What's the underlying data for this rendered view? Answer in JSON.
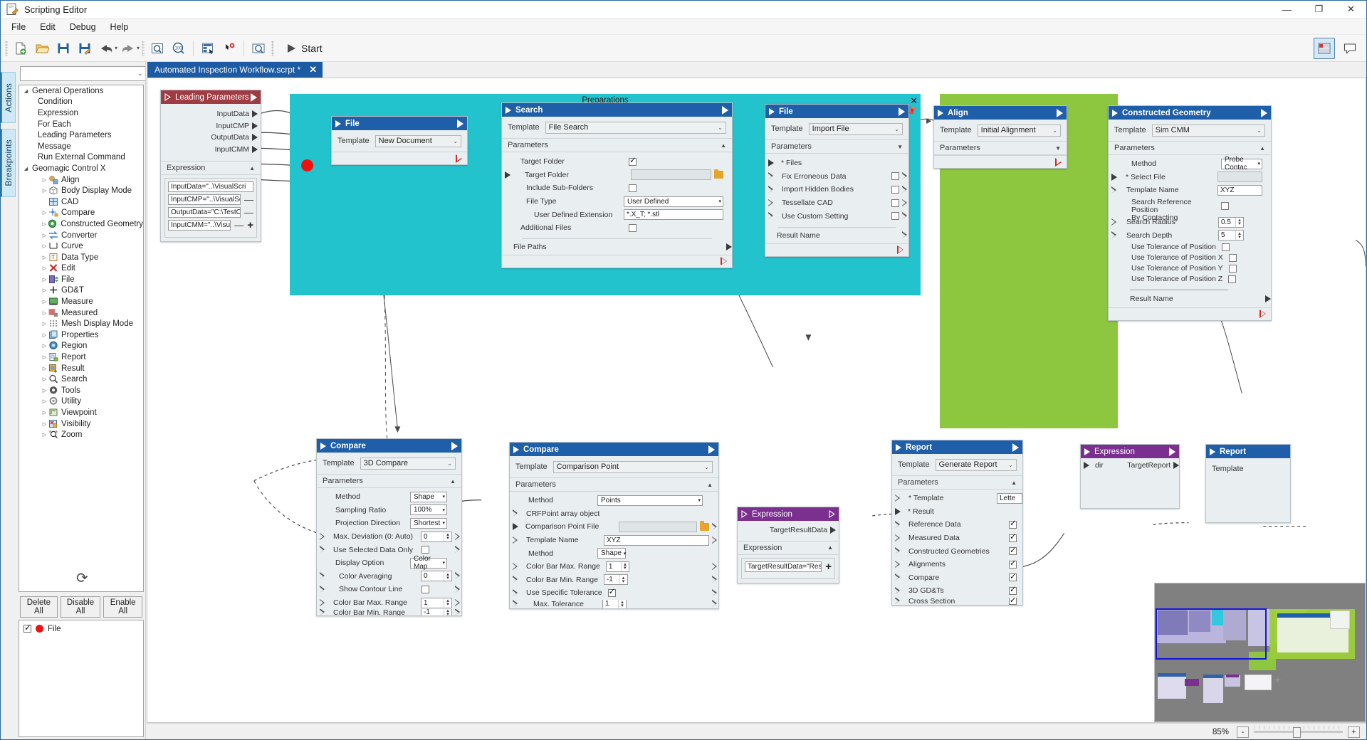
{
  "window": {
    "title": "Scripting Editor",
    "icon": "script-editor-icon",
    "minimize": "—",
    "maximize": "❐",
    "close": "✕"
  },
  "menubar": [
    "File",
    "Edit",
    "Debug",
    "Help"
  ],
  "toolbar": {
    "start_label": "Start",
    "buttons": [
      "new-document-icon",
      "open-folder-icon",
      "save-icon",
      "save-as-icon",
      "undo-icon",
      "redo-icon",
      "zoom-fit-icon",
      "zoom-100-icon",
      "layout-icon",
      "remove-breakpoint-icon",
      "inspect-icon"
    ],
    "right_buttons": [
      "toggle-minimap-icon",
      "toggle-comment-icon"
    ]
  },
  "vertical_tabs": [
    "Actions",
    "Breakpoints"
  ],
  "search": {
    "value": "",
    "placeholder": ""
  },
  "tree": [
    {
      "level": 0,
      "twisty": "expanded",
      "label": "General Operations",
      "icon": ""
    },
    {
      "level": 1,
      "twisty": "",
      "label": "Condition",
      "icon": ""
    },
    {
      "level": 1,
      "twisty": "",
      "label": "Expression",
      "icon": ""
    },
    {
      "level": 1,
      "twisty": "",
      "label": "For Each",
      "icon": ""
    },
    {
      "level": 1,
      "twisty": "",
      "label": "Leading Parameters",
      "icon": ""
    },
    {
      "level": 1,
      "twisty": "",
      "label": "Message",
      "icon": ""
    },
    {
      "level": 1,
      "twisty": "",
      "label": "Run External Command",
      "icon": ""
    },
    {
      "level": 0,
      "twisty": "expanded",
      "label": "Geomagic Control X",
      "icon": ""
    },
    {
      "level": 1,
      "twisty": "collapsed",
      "label": "Align",
      "icon": "align-icon"
    },
    {
      "level": 1,
      "twisty": "collapsed",
      "label": "Body Display Mode",
      "icon": "cube-icon"
    },
    {
      "level": 1,
      "twisty": "",
      "label": "CAD",
      "icon": "cad-icon"
    },
    {
      "level": 1,
      "twisty": "collapsed",
      "label": "Compare",
      "icon": "compare-icon"
    },
    {
      "level": 1,
      "twisty": "collapsed",
      "label": "Constructed Geometry",
      "icon": "geometry-icon"
    },
    {
      "level": 1,
      "twisty": "collapsed",
      "label": "Converter",
      "icon": "converter-icon"
    },
    {
      "level": 1,
      "twisty": "collapsed",
      "label": "Curve",
      "icon": "curve-icon"
    },
    {
      "level": 1,
      "twisty": "collapsed",
      "label": "Data Type",
      "icon": "data-type-icon"
    },
    {
      "level": 1,
      "twisty": "collapsed",
      "label": "Edit",
      "icon": "edit-icon"
    },
    {
      "level": 1,
      "twisty": "collapsed",
      "label": "File",
      "icon": "file-icon"
    },
    {
      "level": 1,
      "twisty": "collapsed",
      "label": "GD&T",
      "icon": "gdt-icon"
    },
    {
      "level": 1,
      "twisty": "collapsed",
      "label": "Measure",
      "icon": "measure-icon"
    },
    {
      "level": 1,
      "twisty": "collapsed",
      "label": "Measured",
      "icon": "measured-icon"
    },
    {
      "level": 1,
      "twisty": "collapsed",
      "label": "Mesh Display Mode",
      "icon": "mesh-icon"
    },
    {
      "level": 1,
      "twisty": "collapsed",
      "label": "Properties",
      "icon": "properties-icon"
    },
    {
      "level": 1,
      "twisty": "collapsed",
      "label": "Region",
      "icon": "region-icon"
    },
    {
      "level": 1,
      "twisty": "collapsed",
      "label": "Report",
      "icon": "report-icon"
    },
    {
      "level": 1,
      "twisty": "collapsed",
      "label": "Result",
      "icon": "result-icon"
    },
    {
      "level": 1,
      "twisty": "collapsed",
      "label": "Search",
      "icon": "search-icon"
    },
    {
      "level": 1,
      "twisty": "collapsed",
      "label": "Tools",
      "icon": "tools-icon"
    },
    {
      "level": 1,
      "twisty": "collapsed",
      "label": "Utility",
      "icon": "gear-icon"
    },
    {
      "level": 1,
      "twisty": "collapsed",
      "label": "Viewpoint",
      "icon": "viewpoint-icon"
    },
    {
      "level": 1,
      "twisty": "collapsed",
      "label": "Visibility",
      "icon": "visibility-icon"
    },
    {
      "level": 1,
      "twisty": "collapsed",
      "label": "Zoom",
      "icon": "zoom-icon"
    }
  ],
  "breakpoints": {
    "buttons": [
      "Delete All",
      "Disable All",
      "Enable All"
    ],
    "items": [
      {
        "checked": true,
        "label": "File"
      }
    ]
  },
  "tab": {
    "title": "Automated Inspection Workflow.scrpt *",
    "close": "✕"
  },
  "groups": [
    {
      "name": "Preparations",
      "color": "#23c3cd"
    },
    {
      "name": "",
      "color": "#8dc63f"
    }
  ],
  "nodes": {
    "leading_parameters": {
      "title": "Leading Parameters",
      "outputs": [
        "InputData",
        "InputCMP",
        "OutputData",
        "InputCMM"
      ],
      "expression_label": "Expression",
      "expressions": [
        "InputData=\"..\\VisualScri",
        "InputCMP=\"..\\VisualScri",
        "OutputData=\"C:\\TestOu",
        "InputCMM=\"..\\VisualScr"
      ]
    },
    "file_new": {
      "title": "File",
      "template_label": "Template",
      "template": "New Document"
    },
    "search": {
      "title": "Search",
      "template_label": "Template",
      "template": "File Search",
      "parameters_label": "Parameters",
      "rows": [
        {
          "label": "Target Folder",
          "type": "check",
          "value": true,
          "indent": 1
        },
        {
          "label": "Target Folder",
          "type": "folder",
          "value": "",
          "indent": 2,
          "port": "in"
        },
        {
          "label": "Include Sub-Folders",
          "type": "check",
          "value": false,
          "indent": 2
        },
        {
          "label": "File Type",
          "type": "dropdown",
          "value": "User Defined",
          "indent": 2
        },
        {
          "label": "User Defined Extension",
          "type": "text",
          "value": "*.X_T; *.stl",
          "indent": 3
        },
        {
          "label": "Additional Files",
          "type": "check",
          "value": false,
          "indent": 1
        }
      ],
      "file_paths_label": "File Paths"
    },
    "file_import": {
      "title": "File",
      "template_label": "Template",
      "template": "Import File",
      "parameters_label": "Parameters",
      "rows": [
        {
          "label": "* Files",
          "type": "none",
          "port": "solid"
        },
        {
          "label": "Fix Erroneous Data",
          "type": "check",
          "value": false,
          "port": "hollow"
        },
        {
          "label": "Import Hidden Bodies",
          "type": "check",
          "value": false,
          "port": "hollow"
        },
        {
          "label": "Tessellate CAD",
          "type": "check",
          "value": false,
          "port": "hollow"
        },
        {
          "label": "Use Custom Setting",
          "type": "check",
          "value": false,
          "port": "hollow"
        }
      ],
      "result_name_label": "Result Name"
    },
    "align": {
      "title": "Align",
      "template_label": "Template",
      "template": "Initial Alignment",
      "parameters_label": "Parameters"
    },
    "constructed_geometry": {
      "title": "Constructed Geometry",
      "template_label": "Template",
      "template": "Sim CMM",
      "parameters_label": "Parameters",
      "rows": [
        {
          "label": "Method",
          "type": "dropdown",
          "value": "Probe Contac"
        },
        {
          "label": "* Select File",
          "type": "grey",
          "value": "",
          "port": "solid"
        },
        {
          "label": "Template Name",
          "type": "text",
          "value": "XYZ",
          "port": "hollow"
        },
        {
          "label": "Search Reference Position\nBy Contacting",
          "type": "check",
          "value": false
        },
        {
          "label": "Search Radius",
          "type": "spin",
          "value": "0.5",
          "port": "hollow"
        },
        {
          "label": "Search Depth",
          "type": "spin",
          "value": "5",
          "port": "hollow"
        },
        {
          "label": "Use Tolerance of Position",
          "type": "check",
          "value": false
        },
        {
          "label": "Use Tolerance of Position X",
          "type": "check",
          "value": false
        },
        {
          "label": "Use Tolerance of Position Y",
          "type": "check",
          "value": false
        },
        {
          "label": "Use Tolerance of Position Z",
          "type": "check",
          "value": false
        }
      ],
      "result_name_label": "Result Name"
    },
    "compare_3d": {
      "title": "Compare",
      "template_label": "Template",
      "template": "3D Compare",
      "parameters_label": "Parameters",
      "rows": [
        {
          "label": "Method",
          "type": "dropdown",
          "value": "Shape"
        },
        {
          "label": "Sampling Ratio",
          "type": "dropdown",
          "value": "100%"
        },
        {
          "label": "Projection Direction",
          "type": "dropdown",
          "value": "Shortest"
        },
        {
          "label": "Max. Deviation (0: Auto)",
          "type": "spin",
          "value": "0",
          "port": "both"
        },
        {
          "label": "Use Selected Data Only",
          "type": "check",
          "value": false,
          "port": "both"
        },
        {
          "label": "Display Option",
          "type": "dropdown",
          "value": "Color Map"
        },
        {
          "label": "Color Averaging",
          "type": "spin",
          "value": "0",
          "port": "both",
          "indent": 1
        },
        {
          "label": "Show Contour Line",
          "type": "check",
          "value": false,
          "port": "both",
          "indent": 1
        },
        {
          "label": "Color Bar Max. Range",
          "type": "spin",
          "value": "1",
          "port": "both"
        },
        {
          "label": "Color Bar Min. Range",
          "type": "spin",
          "value": "-1",
          "port": "both"
        }
      ]
    },
    "compare_point": {
      "title": "Compare",
      "template_label": "Template",
      "template": "Comparison Point",
      "parameters_label": "Parameters",
      "rows": [
        {
          "label": "Method",
          "type": "dropdown",
          "value": "Points"
        },
        {
          "label": "CRFPoint array object",
          "type": "none",
          "port": "hollow"
        },
        {
          "label": "Comparison Point File",
          "type": "folder",
          "value": "",
          "port": "solid"
        },
        {
          "label": "Template Name",
          "type": "text",
          "value": "XYZ",
          "port": "hollow"
        },
        {
          "label": "Method",
          "type": "dropdown-sm",
          "value": "Shape"
        },
        {
          "label": "Color Bar Max. Range",
          "type": "spin",
          "value": "1",
          "port": "hollow"
        },
        {
          "label": "Color Bar Min. Range",
          "type": "spin",
          "value": "-1",
          "port": "hollow"
        },
        {
          "label": "Use Specific Tolerance",
          "type": "check",
          "value": true,
          "port": "hollow"
        },
        {
          "label": "Max. Tolerance",
          "type": "spin",
          "value": "1",
          "port": "hollow",
          "indent": 1
        }
      ]
    },
    "expression_target_result": {
      "title": "Expression",
      "outputs": [
        "TargetResultData"
      ],
      "expression_label": "Expression",
      "expressions": [
        "TargetResultData=\"Resu"
      ]
    },
    "expression_dir": {
      "title": "Expression",
      "inputs": [
        "dir"
      ],
      "outputs": [
        "TargetReport"
      ]
    },
    "report": {
      "title": "Report",
      "template_label": "Template",
      "template": "Generate Report",
      "parameters_label": "Parameters",
      "rows": [
        {
          "label": "* Template",
          "type": "text",
          "value": "Lette",
          "port": "hollow"
        },
        {
          "label": "* Result",
          "type": "none",
          "port": "solid"
        },
        {
          "label": "Reference Data",
          "type": "check",
          "value": true,
          "port": "hollow"
        },
        {
          "label": "Measured Data",
          "type": "check",
          "value": true,
          "port": "hollow"
        },
        {
          "label": "Constructed Geometries",
          "type": "check",
          "value": true,
          "port": "hollow"
        },
        {
          "label": "Alignments",
          "type": "check",
          "value": true,
          "port": "hollow"
        },
        {
          "label": "Compare",
          "type": "check",
          "value": true,
          "port": "hollow"
        },
        {
          "label": "3D GD&Ts",
          "type": "check",
          "value": true,
          "port": "hollow"
        },
        {
          "label": "Cross Section",
          "type": "check",
          "value": true,
          "port": "hollow"
        }
      ]
    },
    "report2": {
      "title": "Report",
      "template_label": "Template"
    }
  },
  "statusbar": {
    "zoom": "85%",
    "minus": "-",
    "plus": "+"
  }
}
